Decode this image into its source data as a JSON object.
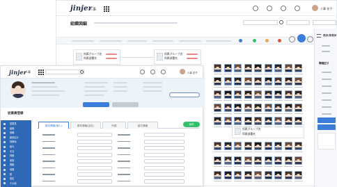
{
  "back": {
    "logo": "jinjer",
    "app": "人事",
    "title": "組織図編",
    "search_placeholder": "",
    "user": "人事 花子",
    "panel_title": "表示/非表示",
    "panel_section": "職種区分",
    "top_buttons": [
      "操作",
      "一覧",
      "表示",
      "切替"
    ]
  },
  "front": {
    "logo": "jinjer",
    "app": "人事",
    "user": "人事 花子",
    "left_title": "従業員登録",
    "tabs": [
      "基本情報(個人)",
      "基本情報(会社)",
      "所属",
      "給与情報"
    ],
    "save_label": "保存",
    "nav_items": [
      "従業員",
      "組織",
      "役職",
      "雇用区分",
      "勤務地",
      "給与",
      "手当",
      "資格",
      "家族",
      "異動",
      "保険",
      "税",
      "設定",
      "その他"
    ]
  },
  "cards": [
    {
      "title": "所属グループ名",
      "sub": "所属部署名"
    },
    {
      "title": "所属グループ名",
      "sub": "所属部署名"
    }
  ],
  "lower_card": {
    "title": "所属グループ名",
    "sub": "所属部署名"
  },
  "colors": {
    "nav": "#2f69b6",
    "accent_blue": "#3b7dd8",
    "green": "#33c26a",
    "orange": "#f3a34b",
    "red": "#e0513f"
  }
}
